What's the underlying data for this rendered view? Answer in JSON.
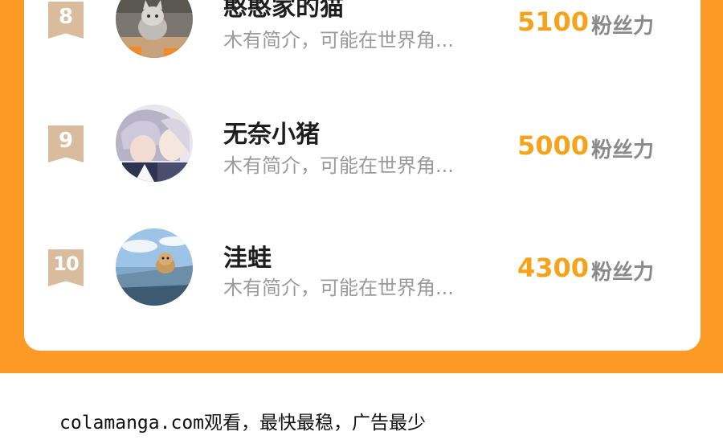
{
  "ranking": {
    "rows": [
      {
        "rank": "8",
        "name": "憨憨家的猫",
        "intro": "木有简介，可能在世界角...",
        "score": "5100",
        "unit": "粉丝力",
        "avatar": "cat-photo-avatar"
      },
      {
        "rank": "9",
        "name": "无奈小猪",
        "intro": "木有简介，可能在世界角...",
        "score": "5000",
        "unit": "粉丝力",
        "avatar": "anime-characters-avatar"
      },
      {
        "rank": "10",
        "name": "洼蛙",
        "intro": "木有简介，可能在世界角...",
        "score": "4300",
        "unit": "粉丝力",
        "avatar": "dog-in-boat-avatar"
      }
    ]
  },
  "footer": {
    "text": "colamanga.com观看，最快最稳，广告最少"
  },
  "colors": {
    "panel": "#fb9b26",
    "score": "#f7a21b",
    "badge": "#d8bc9d"
  }
}
